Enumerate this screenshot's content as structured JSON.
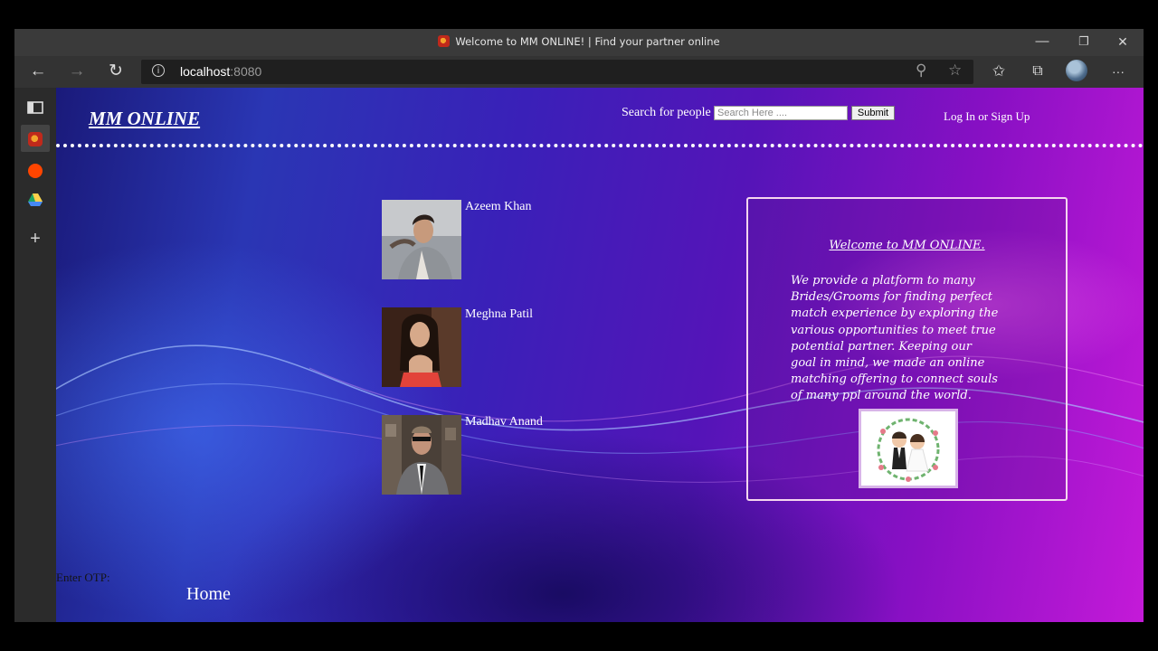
{
  "window": {
    "title": "Welcome to MM ONLINE! | Find your partner online",
    "controls": {
      "minimize": "—",
      "restore": "❐",
      "close": "✕"
    }
  },
  "toolbar": {
    "back_icon": "←",
    "forward_icon": "→",
    "refresh_icon": "↻",
    "url_host": "localhost",
    "url_port": ":8080",
    "zoom_icon": "⚲",
    "favorite_icon": "☆",
    "favorites_icon": "✩",
    "collections_icon": "⧉",
    "more_icon": "···"
  },
  "sidebar": {
    "items": [
      {
        "name": "tab-actions",
        "icon": "▭"
      },
      {
        "name": "active-tab",
        "icon": "favicon"
      },
      {
        "name": "reddit-tab",
        "icon": "reddit"
      },
      {
        "name": "drive-tab",
        "icon": "drive"
      },
      {
        "name": "new-tab",
        "icon": "+"
      }
    ]
  },
  "site": {
    "brand": "MM ONLINE",
    "search_label": "Search for people",
    "search_placeholder": "Search Here ....",
    "submit_label": "Submit",
    "login_label": "Log In or Sign Up"
  },
  "profiles": [
    {
      "name": "Azeem Khan"
    },
    {
      "name": "Meghna Patil"
    },
    {
      "name": "Madhav Anand"
    }
  ],
  "welcome": {
    "title": "Welcome to MM ONLINE.",
    "lines": [
      "We provide a platform to many",
      "Brides/Grooms for finding perfect",
      "match experience by exploring the",
      "various opportunities to meet true",
      "potential partner. Keeping our",
      "goal in mind, we made an online",
      "matching offering to connect souls",
      "of many ppl around the world."
    ]
  },
  "footer": {
    "otp_label": "Enter OTP:",
    "home_label": "Home"
  }
}
